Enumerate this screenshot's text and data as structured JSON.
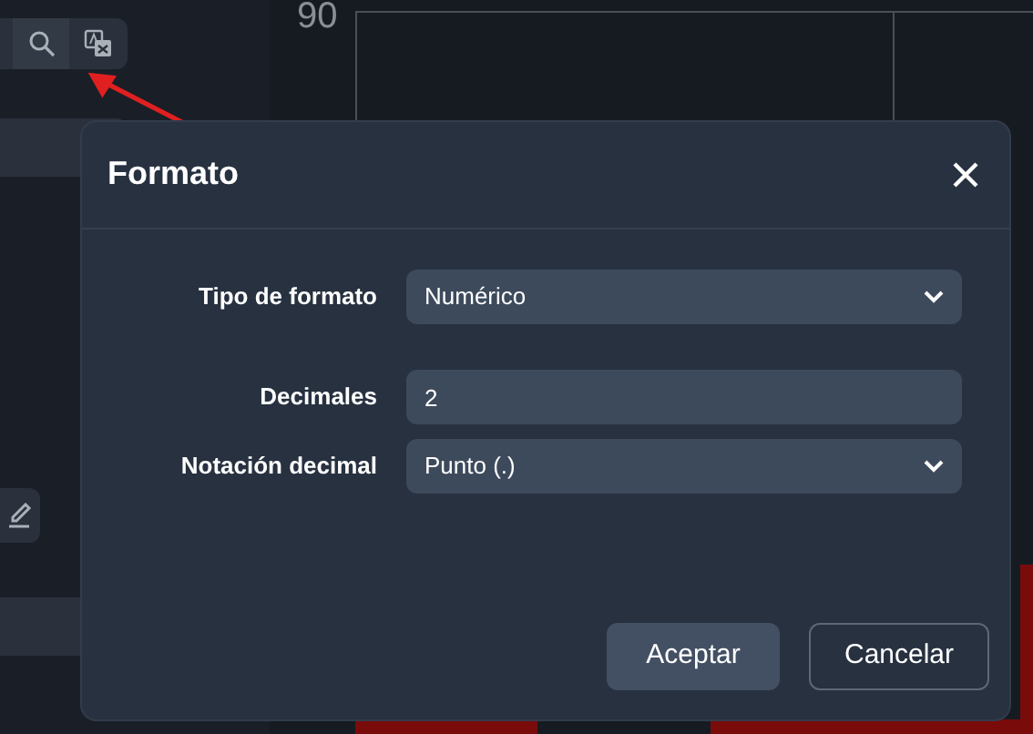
{
  "chart": {
    "y_axis_labels": [
      "90"
    ]
  },
  "dialog": {
    "title": "Formato",
    "fields": [
      {
        "kind": "select",
        "label": "Tipo de formato",
        "value": "Numérico"
      },
      {
        "kind": "input",
        "label": "Decimales",
        "value": "2"
      },
      {
        "kind": "select",
        "label": "Notación decimal",
        "value": "Punto (.)"
      }
    ],
    "buttons": [
      {
        "kind": "primary",
        "label": "Aceptar"
      },
      {
        "kind": "secondary",
        "label": "Cancelar"
      }
    ]
  }
}
